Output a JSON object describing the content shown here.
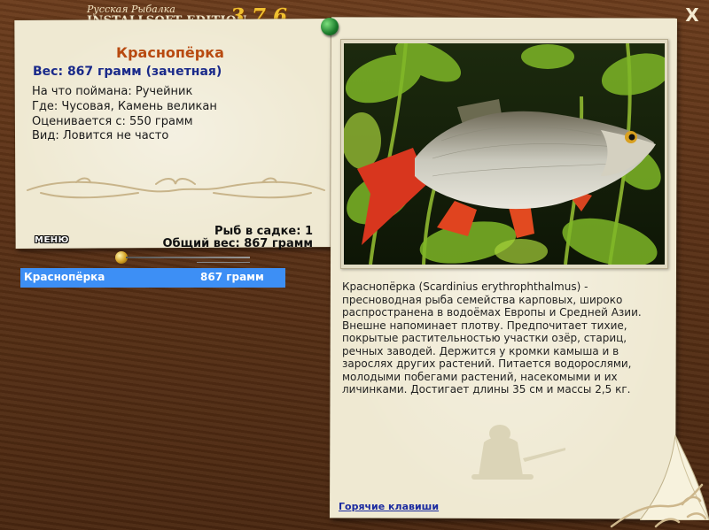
{
  "window": {
    "logo_small": "Русская Рыбалка",
    "logo_big": "INSTALLSOFT EDITION",
    "version": "3.7.6",
    "close_label": "X"
  },
  "fish": {
    "name": "Краснопёрка",
    "weight_line": "Вес: 867 грамм (зачетная)",
    "caught_with": "На что поймана: Ручейник",
    "location": "Где: Чусовая, Камень великан",
    "rated_from": "Оценивается с: 550 грамм",
    "species_type": "Вид: Ловится не часто",
    "description": "Краснопёрка (Scardinius erythrophthalmus) - пресноводная рыба семейства карповых, широко распространена в водоёмах Европы и Средней Азии. Внешне напоминает плотву. Предпочитает тихие, покрытые растительностью участки озёр, стариц, речных заводей. Держится у кромки камыша и в зарослях других растений. Питается водорослями, молодыми побегами растений, насекомыми и их личинками. Достигает длины 35 см и массы 2,5 кг."
  },
  "keepnet": {
    "fish_count": "Рыб в садке: 1",
    "total_weight": "Общий вес: 867 грамм",
    "menu_label": "МЕНЮ",
    "catches": [
      {
        "name": "Краснопёрка",
        "weight": "867 грамм"
      }
    ]
  },
  "footer": {
    "hotkeys_label": "Горячие клавиши"
  },
  "colors": {
    "frame_wood": "#5a3116",
    "paper": "#efe9d2",
    "selection": "#3d8ff5",
    "title_orange": "#b84a10",
    "weight_blue": "#1a2a8a"
  }
}
